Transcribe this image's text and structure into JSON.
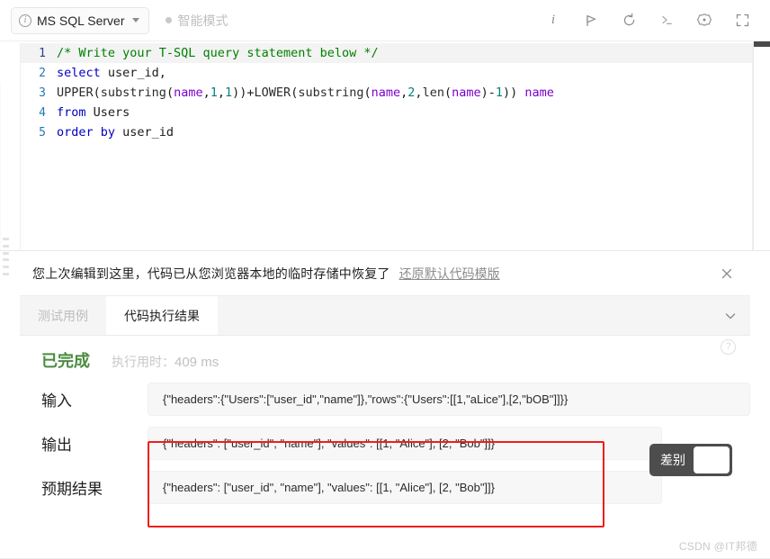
{
  "toolbar": {
    "language_label": "MS SQL Server",
    "info_icon": "info-circle-icon",
    "dropdown_icon": "chevron-down-icon",
    "mode_label": "智能模式",
    "actions": [
      {
        "name": "info-button",
        "icon": "info-italic-icon",
        "glyph": "i"
      },
      {
        "name": "run-button",
        "icon": "play-flag-icon"
      },
      {
        "name": "reset-button",
        "icon": "undo-arrow-icon"
      },
      {
        "name": "console-button",
        "icon": "terminal-icon"
      },
      {
        "name": "settings-button",
        "icon": "gear-icon"
      },
      {
        "name": "fullscreen-button",
        "icon": "expand-icon"
      }
    ]
  },
  "editor": {
    "lines": [
      {
        "num": "1",
        "tokens": [
          {
            "t": "comment",
            "s": "/* Write your T-SQL query statement below */"
          }
        ]
      },
      {
        "num": "2",
        "tokens": [
          {
            "t": "kw",
            "s": "select"
          },
          {
            "t": "plain",
            "s": " user_id,"
          }
        ]
      },
      {
        "num": "3",
        "tokens": [
          {
            "t": "fn",
            "s": "UPPER"
          },
          {
            "t": "punc",
            "s": "("
          },
          {
            "t": "fn",
            "s": "substring"
          },
          {
            "t": "punc",
            "s": "("
          },
          {
            "t": "ident",
            "s": "name"
          },
          {
            "t": "punc",
            "s": ","
          },
          {
            "t": "num",
            "s": "1"
          },
          {
            "t": "punc",
            "s": ","
          },
          {
            "t": "num",
            "s": "1"
          },
          {
            "t": "punc",
            "s": "))+"
          },
          {
            "t": "fn",
            "s": "LOWER"
          },
          {
            "t": "punc",
            "s": "("
          },
          {
            "t": "fn",
            "s": "substring"
          },
          {
            "t": "punc",
            "s": "("
          },
          {
            "t": "ident",
            "s": "name"
          },
          {
            "t": "punc",
            "s": ","
          },
          {
            "t": "num",
            "s": "2"
          },
          {
            "t": "punc",
            "s": ","
          },
          {
            "t": "fn",
            "s": "len"
          },
          {
            "t": "punc",
            "s": "("
          },
          {
            "t": "ident",
            "s": "name"
          },
          {
            "t": "punc",
            "s": ")-"
          },
          {
            "t": "num",
            "s": "1"
          },
          {
            "t": "punc",
            "s": ")) "
          },
          {
            "t": "ident",
            "s": "name"
          }
        ]
      },
      {
        "num": "4",
        "tokens": [
          {
            "t": "kw",
            "s": "from"
          },
          {
            "t": "plain",
            "s": " Users"
          }
        ]
      },
      {
        "num": "5",
        "tokens": [
          {
            "t": "kw",
            "s": "order by"
          },
          {
            "t": "plain",
            "s": " user_id"
          }
        ]
      }
    ]
  },
  "notice": {
    "message": "您上次编辑到这里，代码已从您浏览器本地的临时存储中恢复了",
    "link_label": "还原默认代码模版",
    "close_icon": "close-icon"
  },
  "tabs": {
    "items": [
      {
        "label": "测试用例",
        "active": false
      },
      {
        "label": "代码执行结果",
        "active": true
      }
    ],
    "collapse_icon": "chevron-down-icon"
  },
  "result": {
    "status_label": "已完成",
    "time_label": "执行用时：",
    "time_value": "409 ms",
    "help_icon": "question-circle-icon",
    "rows": [
      {
        "label": "输入",
        "value": "{\"headers\":{\"Users\":[\"user_id\",\"name\"]},\"rows\":{\"Users\":[[1,\"aLice\"],[2,\"bOB\"]]}}"
      },
      {
        "label": "输出",
        "value": "{\"headers\": [\"user_id\", \"name\"], \"values\": [[1, \"Alice\"], [2, \"Bob\"]]}"
      },
      {
        "label": "预期结果",
        "value": "{\"headers\": [\"user_id\", \"name\"], \"values\": [[1, \"Alice\"], [2, \"Bob\"]]}"
      }
    ],
    "diff_toggle_label": "差别",
    "highlight_color": "#f21d1d"
  },
  "watermark": "CSDN @IT邦德"
}
